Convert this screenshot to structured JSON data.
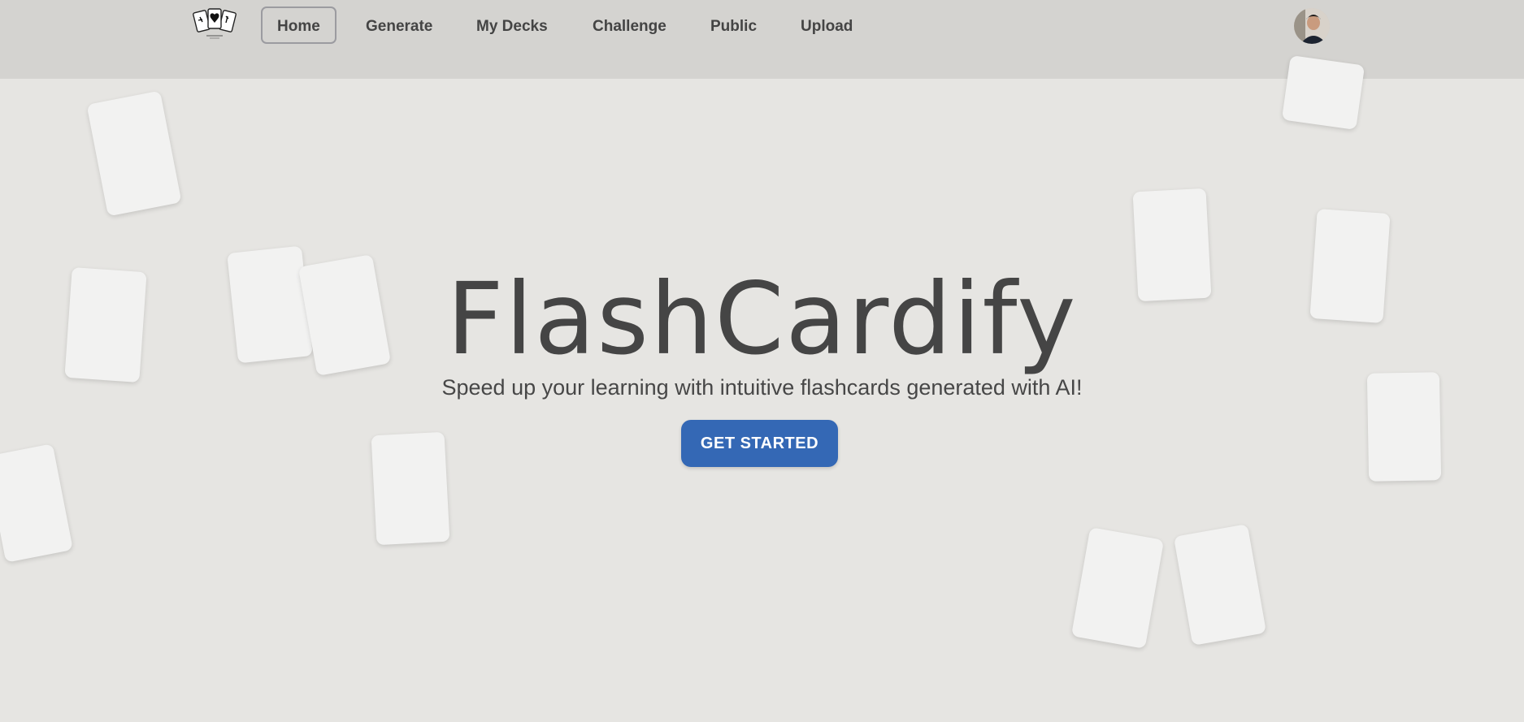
{
  "nav": {
    "items": [
      {
        "label": "Home",
        "active": true
      },
      {
        "label": "Generate",
        "active": false
      },
      {
        "label": "My Decks",
        "active": false
      },
      {
        "label": "Challenge",
        "active": false
      },
      {
        "label": "Public",
        "active": false
      },
      {
        "label": "Upload",
        "active": false
      }
    ],
    "logo_icon": "playing-cards-logo",
    "avatar_icon": "user-avatar-photo"
  },
  "hero": {
    "title": "FlashCardify",
    "subtitle": "Speed up your learning with intuitive flashcards generated with AI!",
    "cta_label": "GET STARTED"
  },
  "colors": {
    "navbar_bg": "#d4d3d0",
    "page_bg": "#e6e5e2",
    "cta_bg": "#3468b5",
    "text": "#454545",
    "card": "#f2f2f1"
  }
}
